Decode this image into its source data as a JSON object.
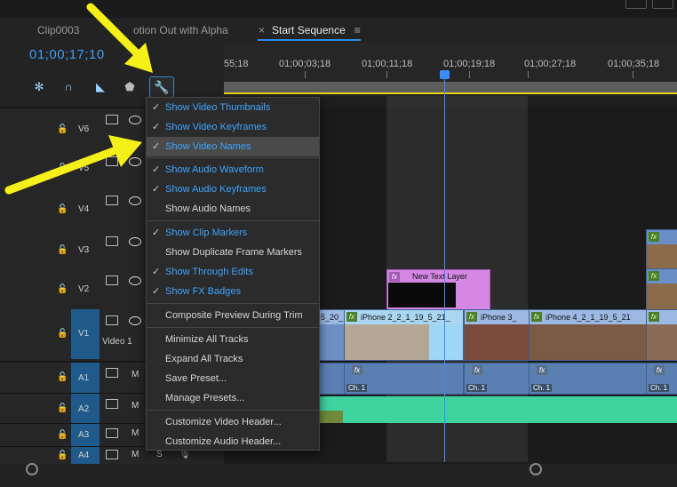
{
  "tabs": [
    {
      "label": "Clip0003"
    },
    {
      "label": "otion Out with Alpha"
    },
    {
      "label": "Start Sequence",
      "close": "×",
      "menu": "≡"
    }
  ],
  "timecode": "01;00;17;10",
  "ruler": {
    "labels": [
      "55;18",
      "01;00;03;18",
      "01;00;11;18",
      "01;00;19;18",
      "01;00;27;18",
      "01;00;35;18"
    ]
  },
  "tracks": {
    "video": [
      {
        "name": "V6"
      },
      {
        "name": "V5"
      },
      {
        "name": "V4"
      },
      {
        "name": "V3"
      },
      {
        "name": "V2"
      },
      {
        "name": "V1",
        "label": "Video 1"
      }
    ],
    "audio": [
      {
        "name": "A1",
        "mute": "M"
      },
      {
        "name": "A2",
        "mute": "M"
      },
      {
        "name": "A3",
        "mute": "M"
      },
      {
        "name": "A4",
        "mute": "M",
        "solo": "S"
      }
    ]
  },
  "clips": {
    "video1": [
      {
        "title": "5_20_"
      },
      {
        "title": "iPhone 2_2_1_19_5_21_"
      },
      {
        "title": "iPhone 3_"
      },
      {
        "title": "iPhone 4_2_1_19_5_21"
      },
      {
        "title": ""
      }
    ],
    "text_layer": {
      "title": "New Text Layer"
    },
    "audio_channel_label": "Ch. 1"
  },
  "menu": {
    "items": [
      {
        "label": "Show Video Thumbnails",
        "checked": true
      },
      {
        "label": "Show Video Keyframes",
        "checked": true
      },
      {
        "label": "Show Video Names",
        "checked": true,
        "highlighted": true
      },
      {
        "label": "Show Audio Waveform",
        "checked": true
      },
      {
        "label": "Show Audio Keyframes",
        "checked": true
      },
      {
        "label": "Show Audio Names",
        "checked": false
      },
      {
        "label": "Show Clip Markers",
        "checked": true
      },
      {
        "label": "Show Duplicate Frame Markers",
        "checked": false
      },
      {
        "label": "Show Through Edits",
        "checked": true
      },
      {
        "label": "Show FX Badges",
        "checked": true
      },
      {
        "label": "Composite Preview During Trim",
        "checked": false
      },
      {
        "label": "Minimize All Tracks",
        "checked": false
      },
      {
        "label": "Expand All Tracks",
        "checked": false
      },
      {
        "label": "Save Preset...",
        "checked": false
      },
      {
        "label": "Manage Presets...",
        "checked": false
      },
      {
        "label": "Customize Video Header...",
        "checked": false
      },
      {
        "label": "Customize Audio Header...",
        "checked": false
      }
    ],
    "check_glyph": "✓"
  },
  "colors": {
    "accent": "#3ea4ff",
    "arrow": "#f5ef1a",
    "audio_wave": "#3fd3a0",
    "text_layer": "#d488e4"
  }
}
